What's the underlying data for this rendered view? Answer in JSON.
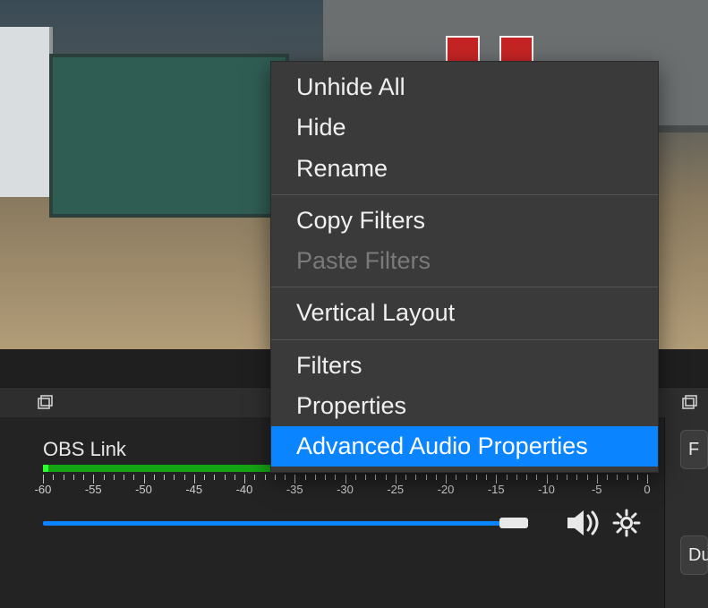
{
  "contextMenu": {
    "items": [
      {
        "label": "Unhide All",
        "enabled": true,
        "selected": false
      },
      {
        "label": "Hide",
        "enabled": true,
        "selected": false
      },
      {
        "label": "Rename",
        "enabled": true,
        "selected": false
      },
      {
        "type": "sep"
      },
      {
        "label": "Copy Filters",
        "enabled": true,
        "selected": false
      },
      {
        "label": "Paste Filters",
        "enabled": false,
        "selected": false
      },
      {
        "type": "sep"
      },
      {
        "label": "Vertical Layout",
        "enabled": true,
        "selected": false
      },
      {
        "type": "sep"
      },
      {
        "label": "Filters",
        "enabled": true,
        "selected": false
      },
      {
        "label": "Properties",
        "enabled": true,
        "selected": false
      },
      {
        "label": "Advanced Audio Properties",
        "enabled": true,
        "selected": true
      }
    ]
  },
  "mixer": {
    "sourceName": "OBS Link",
    "scaleLabels": [
      "-60",
      "-55",
      "-50",
      "-45",
      "-40",
      "-35",
      "-30",
      "-25",
      "-20",
      "-15",
      "-10",
      "-5",
      "0"
    ],
    "volumePercent": 94,
    "speaker": "speaker-icon",
    "gear": "gear-icon"
  },
  "sidePanel": {
    "btn1": "F",
    "btn2": "Du"
  },
  "colors": {
    "accent": "#0a84ff",
    "meterGreen": "#14a514",
    "meterYellow": "#a58d14",
    "meterRed": "#a51414"
  }
}
